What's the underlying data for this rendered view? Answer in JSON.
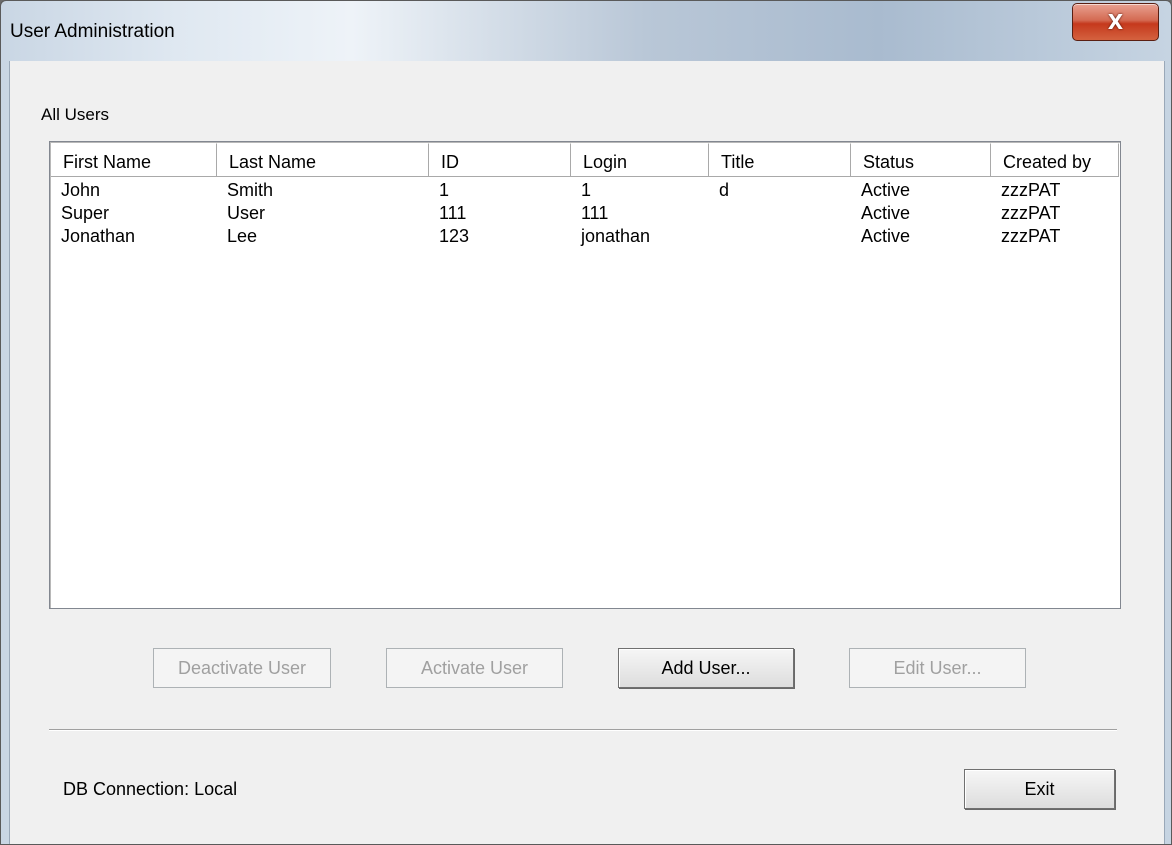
{
  "window": {
    "title": "User Administration",
    "close_symbol": "X"
  },
  "group": {
    "label": "All Users"
  },
  "table": {
    "headers": [
      "First Name",
      "Last Name",
      "ID",
      "Login",
      "Title",
      "Status",
      "Created by"
    ],
    "rows": [
      [
        "John",
        "Smith",
        "1",
        "1",
        "d",
        "Active",
        "zzzPAT"
      ],
      [
        "Super",
        "User",
        "111",
        "111",
        "",
        "Active",
        "zzzPAT"
      ],
      [
        "Jonathan",
        "Lee",
        "123",
        "jonathan",
        "",
        "Active",
        "zzzPAT"
      ]
    ]
  },
  "buttons": {
    "deactivate": "Deactivate User",
    "activate": "Activate User",
    "add": "Add User...",
    "edit": "Edit User...",
    "exit": "Exit"
  },
  "status": {
    "db_connection": "DB Connection: Local"
  }
}
